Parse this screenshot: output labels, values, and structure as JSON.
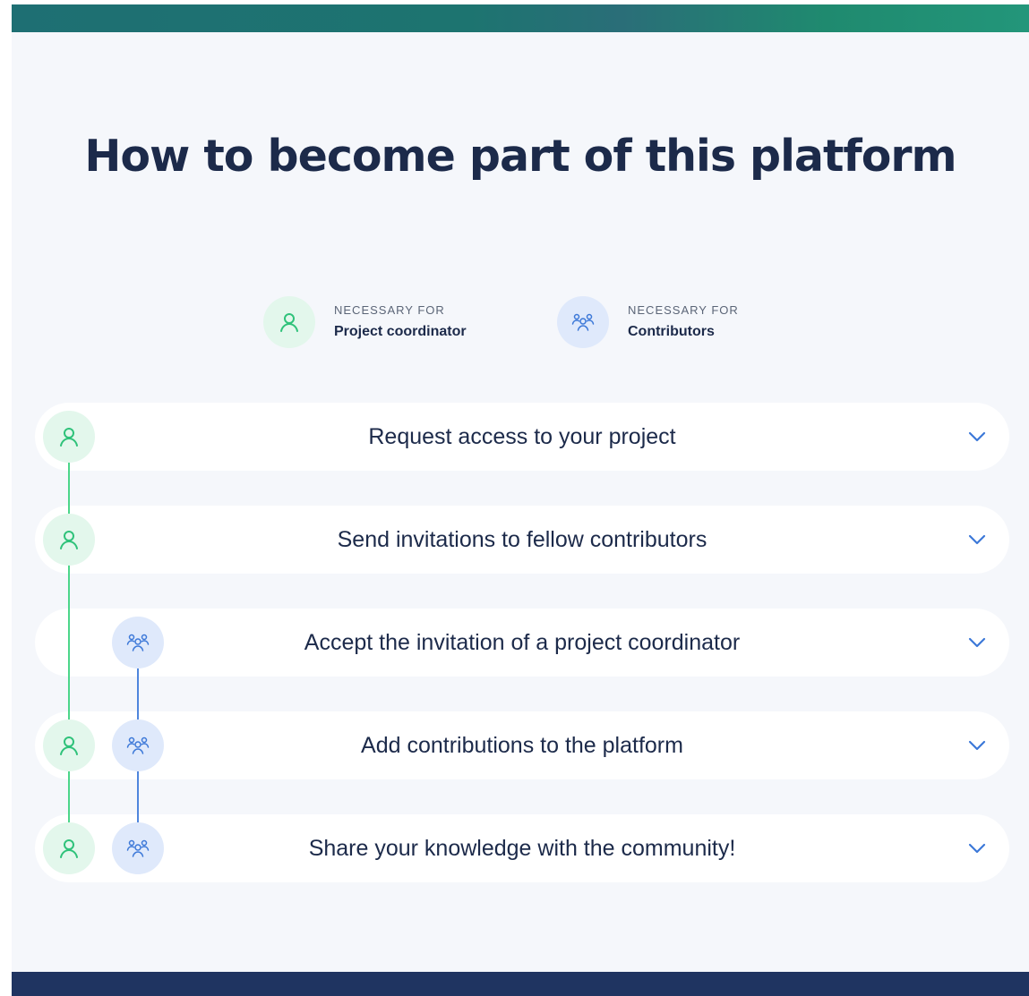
{
  "heading": {
    "title": "How to become part of this platform"
  },
  "legend": [
    {
      "caption": "NECESSARY FOR",
      "role": "Project coordinator",
      "icon": "person-icon"
    },
    {
      "caption": "NECESSARY FOR",
      "role": "Contributors",
      "icon": "group-icon"
    }
  ],
  "steps": [
    {
      "label": "Request access to your project",
      "coordinator": true,
      "contributors": false
    },
    {
      "label": "Send invitations to fellow contributors",
      "coordinator": true,
      "contributors": false
    },
    {
      "label": "Accept the invitation of a project coordinator",
      "coordinator": false,
      "contributors": true
    },
    {
      "label": "Add contributions to the platform",
      "coordinator": true,
      "contributors": true
    },
    {
      "label": "Share your knowledge with the community!",
      "coordinator": true,
      "contributors": true
    }
  ],
  "colors": {
    "title": "#1c2a4a",
    "coordinator_accent": "#2fc27a",
    "coordinator_bg": "#e3f7ec",
    "contributor_accent": "#3c78d8",
    "contributor_bg": "#dfe9fb",
    "chevron": "#3c78d8",
    "top_banner": "#1e7470",
    "footer": "#1f3461"
  },
  "icons": {
    "coordinator": "person-icon",
    "contributors": "group-icon",
    "expand": "chevron-down-icon"
  }
}
